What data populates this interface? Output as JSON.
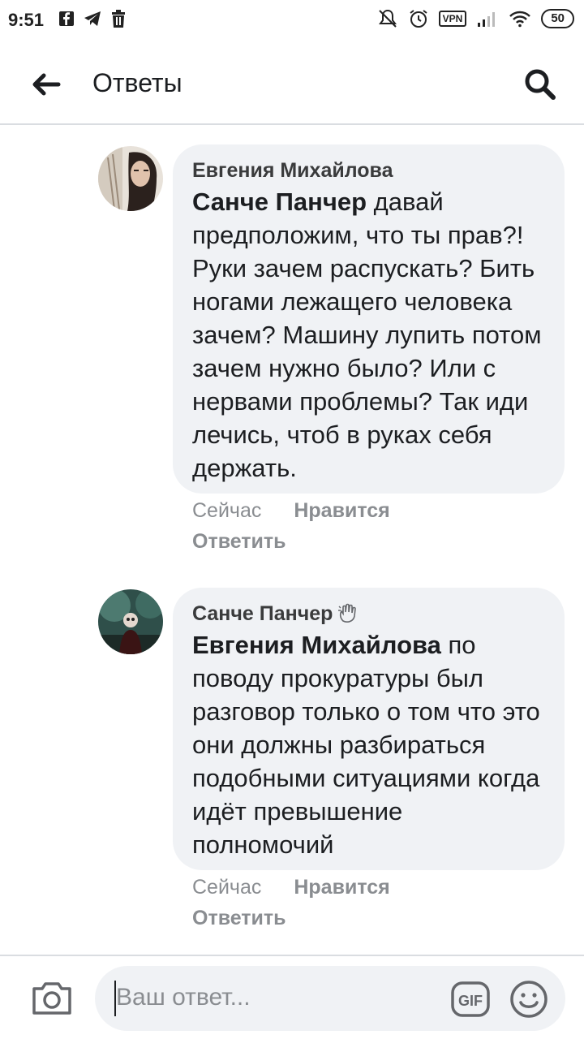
{
  "status_bar": {
    "time": "9:51",
    "vpn": "VPN",
    "battery": "50"
  },
  "header": {
    "title": "Ответы"
  },
  "comments": [
    {
      "author": "Евгения Михайлова",
      "mention": "Санче Панчер",
      "text": " давай предположим, что ты прав?! Руки зачем распускать? Бить ногами лежащего человека зачем? Машину лупить потом зачем нужно было? Или с нервами проблемы? Так иди лечись, чтоб в руках себя держать.",
      "time": "Сейчас",
      "like_label": "Нравится",
      "reply_label": "Ответить"
    },
    {
      "author": "Санче Панчер",
      "mention": "Евгения Михайлова",
      "text": "  по поводу прокуратуры был разговор только о том что это они должны разбираться подобными ситуациями когда идёт превышение полномочий",
      "time": "Сейчас",
      "like_label": "Нравится",
      "reply_label": "Ответить"
    }
  ],
  "composer": {
    "placeholder": "Ваш ответ...",
    "gif_label": "GIF"
  }
}
